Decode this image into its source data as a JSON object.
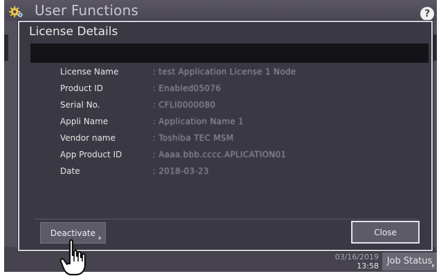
{
  "window": {
    "title": "User Functions",
    "help_icon": "question-mark-icon",
    "gear_icon": "gear-icon"
  },
  "dialog": {
    "title": "License Details",
    "fields": [
      {
        "label": "License Name",
        "value": ": test Application License 1 Node"
      },
      {
        "label": "Product ID",
        "value": ": Enabled05076"
      },
      {
        "label": "Serial No.",
        "value": ": CFLI0000080"
      },
      {
        "label": "Appli Name",
        "value": ": Application Name 1"
      },
      {
        "label": "Vendor name",
        "value": ": Toshiba TEC MSM"
      },
      {
        "label": "App Product ID",
        "value": ": Aaaa.bbb.cccc.APLICATION01"
      },
      {
        "label": "Date",
        "value": ": 2018-03-23"
      }
    ],
    "buttons": {
      "deactivate": "Deactivate",
      "close": "Close"
    }
  },
  "status_bar": {
    "date": "03/16/2019",
    "time": "13:58",
    "job_status": "Job Status"
  },
  "colors": {
    "screen_bg": "#53505c",
    "dialog_bg": "#3a3842",
    "dialog_border": "#d7d5dc",
    "button_bg": "#5e5b68",
    "header_bar": "#141318"
  }
}
